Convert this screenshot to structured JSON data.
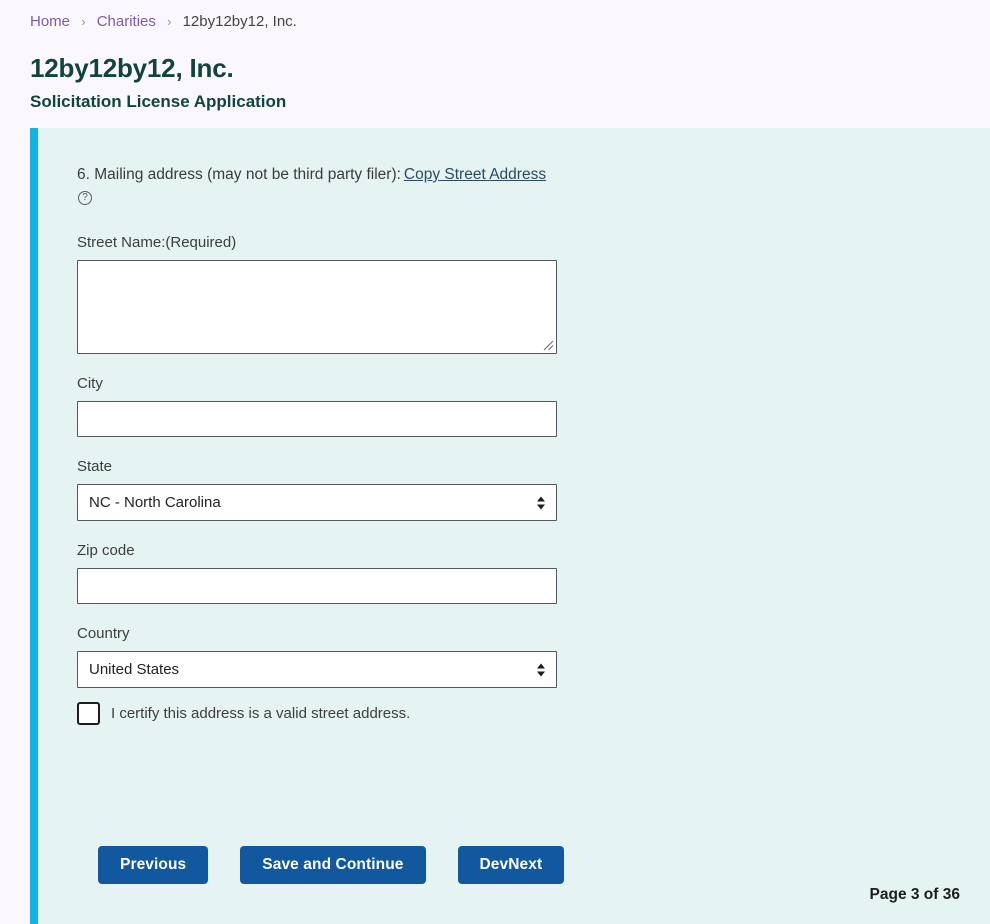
{
  "breadcrumb": {
    "items": [
      {
        "label": "Home",
        "current": false
      },
      {
        "label": "Charities",
        "current": false
      },
      {
        "label": "12by12by12, Inc.",
        "current": true
      }
    ],
    "separator": "›"
  },
  "header": {
    "title": "12by12by12, Inc.",
    "subtitle": "Solicitation License Application"
  },
  "form": {
    "question": {
      "number_and_text": "6. Mailing address (may not be third party filer):",
      "copy_link_label": "Copy Street Address",
      "help_icon_glyph": "?"
    },
    "fields": {
      "street_name": {
        "label": "Street Name:(Required)",
        "value": "",
        "placeholder": ""
      },
      "city": {
        "label": "City",
        "value": "",
        "placeholder": ""
      },
      "state": {
        "label": "State",
        "value": "NC - North Carolina",
        "options": [
          "NC - North Carolina"
        ]
      },
      "zip_code": {
        "label": "Zip code",
        "value": "",
        "placeholder": ""
      },
      "country": {
        "label": "Country",
        "value": "United States",
        "options": [
          "United States"
        ]
      }
    },
    "certify_checkbox": {
      "label": "I certify this address is a valid street address.",
      "checked": false
    }
  },
  "footer": {
    "buttons": {
      "previous": "Previous",
      "save_and_continue": "Save and Continue",
      "dev_next": "DevNext"
    },
    "page_counter": "Page 3 of 36"
  },
  "colors": {
    "accent_bar": "#10b4e2",
    "panel_background": "#e5f4f3",
    "page_background": "#faf8fc",
    "heading": "#12433e",
    "breadcrumb_link": "#7c5ca8",
    "button": "#11589f",
    "link": "#2c4a61"
  }
}
